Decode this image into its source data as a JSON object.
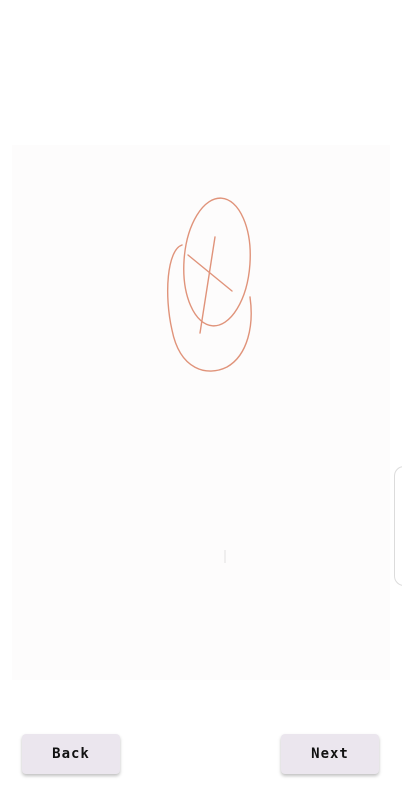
{
  "drawing": {
    "stroke_color": "#e0937a"
  },
  "navigation": {
    "back_label": "Back",
    "next_label": "Next"
  }
}
